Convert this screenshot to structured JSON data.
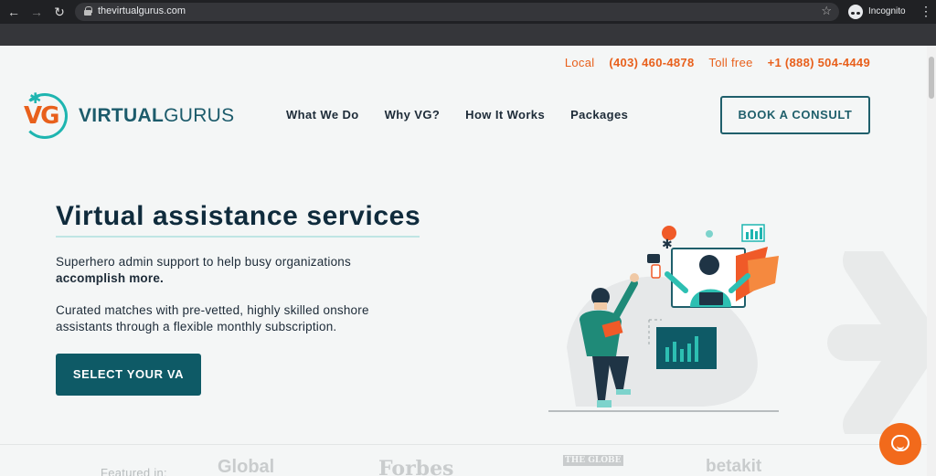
{
  "browser": {
    "url": "thevirtualgurus.com",
    "incognito_label": "Incognito"
  },
  "contact": {
    "local_label": "Local",
    "local_number": "(403) 460-4878",
    "tollfree_label": "Toll free",
    "tollfree_number": "+1 (888) 504-4449"
  },
  "logo": {
    "mark": "VG",
    "text_bold": "VIRTUAL",
    "text_light": "GURUS"
  },
  "nav": {
    "items": [
      "What We Do",
      "Why VG?",
      "How It Works",
      "Packages"
    ]
  },
  "cta": {
    "consult": "BOOK A CONSULT",
    "select_va": "SELECT YOUR VA"
  },
  "hero": {
    "title": "Virtual assistance services",
    "p1_start": "Superhero admin support to help busy organizations ",
    "p1_bold": "accomplish more.",
    "p2": "Curated matches with pre-vetted, highly skilled onshore assistants through a flexible monthly subscription."
  },
  "featured": {
    "label": "Featured in:",
    "press": [
      "Global",
      "Forbes",
      "THE GLOBE",
      "betakit"
    ]
  },
  "colors": {
    "accent_orange": "#e8601c",
    "teal": "#1eb5b0",
    "dark_teal": "#0e5a66",
    "navy": "#0f2b3c"
  }
}
